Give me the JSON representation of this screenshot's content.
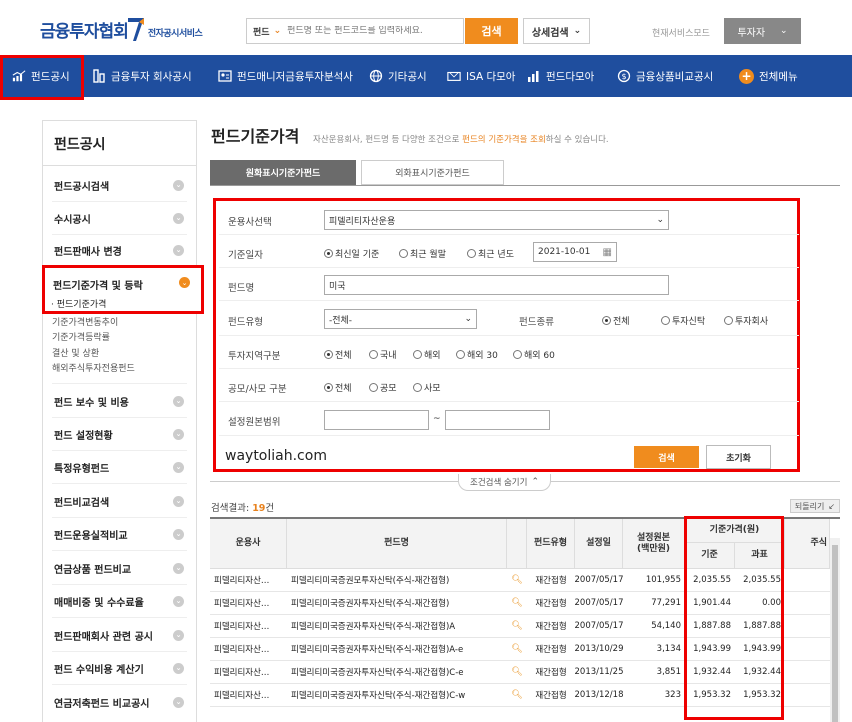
{
  "header": {
    "logo_main": "금융투자협회",
    "logo_sub": "전자공시서비스",
    "search_type": "펀드",
    "search_placeholder": "펀드명 또는 펀드코드를 입력하세요.",
    "search_button": "검색",
    "advanced_search": "상세검색",
    "mode_label": "현재서비스모드",
    "mode_value": "투자자"
  },
  "nav": {
    "items": [
      {
        "label": "펀드공시",
        "icon": "chart-icon"
      },
      {
        "label": "금융투자 회사공시",
        "icon": "building-icon"
      },
      {
        "label": "펀드매니저금융투자분석사",
        "icon": "person-card-icon"
      },
      {
        "label": "기타공시",
        "icon": "globe-icon"
      },
      {
        "label": "ISA 다모아",
        "icon": "isa-icon"
      },
      {
        "label": "펀드다모아",
        "icon": "bars-icon"
      },
      {
        "label": "금융상품비교공시",
        "icon": "coin-icon"
      },
      {
        "label": "전체메뉴",
        "icon": "plus-icon"
      }
    ]
  },
  "sidebar": {
    "title": "펀드공시",
    "items": [
      {
        "label": "펀드공시검색"
      },
      {
        "label": "수시공시"
      },
      {
        "label": "펀드판매사 변경"
      },
      {
        "label": "펀드기준가격 및 등락"
      },
      {
        "label": "펀드 보수 및 비용"
      },
      {
        "label": "펀드 설정현황"
      },
      {
        "label": "특정유형펀드"
      },
      {
        "label": "펀드비교검색"
      },
      {
        "label": "펀드운용실적비교"
      },
      {
        "label": "연금상품 펀드비교"
      },
      {
        "label": "매매비중 및 수수료율"
      },
      {
        "label": "펀드판매회사 관련 공시"
      },
      {
        "label": "펀드 수익비용 계산기"
      },
      {
        "label": "연금저축펀드 비교공시"
      }
    ],
    "subitems": [
      "펀드기준가격",
      "기준가격변동추이",
      "기준가격등락률",
      "결산 및 상환",
      "해외주식투자전용펀드"
    ]
  },
  "main": {
    "title": "펀드기준가격",
    "desc_before": "자산운용회사, 펀드명 등 다양한 조건으로 ",
    "desc_highlight": "펀드의 기준가격을 조회",
    "desc_after": "하실 수 있습니다.",
    "tabs": [
      "원화표시기준가펀드",
      "외화표시기준가펀드"
    ]
  },
  "form": {
    "company_label": "운용사선택",
    "company_value": "피델리티자산운용",
    "date_label": "기준일자",
    "date_options": [
      "최신일 기준",
      "최근 월말",
      "최근 년도"
    ],
    "date_value": "2021-10-01",
    "fund_name_label": "펀드명",
    "fund_name_value": "미국",
    "fund_type_label": "펀드유형",
    "fund_type_value": "-전체-",
    "fund_kind_label": "펀드종류",
    "fund_kind_options": [
      "전체",
      "투자신탁",
      "투자회사"
    ],
    "region_label": "투자지역구분",
    "region_options": [
      "전체",
      "국내",
      "해외",
      "해외 30",
      "해외 60"
    ],
    "offer_label": "공모/사모 구분",
    "offer_options": [
      "전체",
      "공모",
      "사모"
    ],
    "range_label": "설정원본범위",
    "range_sep": "~",
    "search_button": "검색",
    "reset_button": "초기화",
    "watermark": "waytoliah.com",
    "toggle_label": "조건검색 숨기기"
  },
  "results": {
    "count_label": "검색결과: ",
    "count": "19",
    "count_unit": "건",
    "back_button": "되돌리기",
    "headers": {
      "company": "운용사",
      "fund_name": "펀드명",
      "fund_type": "펀드유형",
      "setup_date": "설정일",
      "setup_amount": "설정원본 (백만원)",
      "price": "기준가격(원)",
      "price_base": "기준",
      "price_tax": "과표",
      "extra": "주식"
    },
    "rows": [
      {
        "company": "피델리티자산…",
        "name": "피델리티미국증권모투자신탁(주식-재간접형)",
        "type": "재간접형",
        "date": "2007/05/17",
        "amount": "101,955",
        "base": "2,035.55",
        "tax": "2,035.55"
      },
      {
        "company": "피델리티자산…",
        "name": "피델리티미국증권자투자신탁(주식-재간접형)",
        "type": "재간접형",
        "date": "2007/05/17",
        "amount": "77,291",
        "base": "1,901.44",
        "tax": "0.00"
      },
      {
        "company": "피델리티자산…",
        "name": "피델리티미국증권자투자신탁(주식-재간접형)A",
        "type": "재간접형",
        "date": "2007/05/17",
        "amount": "54,140",
        "base": "1,887.88",
        "tax": "1,887.88"
      },
      {
        "company": "피델리티자산…",
        "name": "피델리티미국증권자투자신탁(주식-재간접형)A-e",
        "type": "재간접형",
        "date": "2013/10/29",
        "amount": "3,134",
        "base": "1,943.99",
        "tax": "1,943.99"
      },
      {
        "company": "피델리티자산…",
        "name": "피델리티미국증권자투자신탁(주식-재간접형)C-e",
        "type": "재간접형",
        "date": "2013/11/25",
        "amount": "3,851",
        "base": "1,932.44",
        "tax": "1,932.44"
      },
      {
        "company": "피델리티자산…",
        "name": "피델리티미국증권자투자신탁(주식-재간접형)C-w",
        "type": "재간접형",
        "date": "2013/12/18",
        "amount": "323",
        "base": "1,953.32",
        "tax": "1,953.32"
      }
    ]
  },
  "colors": {
    "brand_blue": "#1f4e9e",
    "accent_orange": "#f08c1e",
    "highlight_red": "#e00000"
  }
}
